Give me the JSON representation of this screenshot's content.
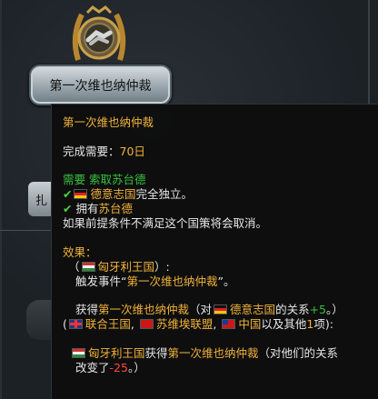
{
  "focus": {
    "name": "第一次维也纳仲裁",
    "side_label": "扎"
  },
  "tooltip": {
    "title": "第一次维也纳仲裁",
    "completion_label": "完成需要：",
    "completion_value": "70日",
    "requires_header": "需要 索取苏台德",
    "req1_country": "德意志国",
    "req1_suffix": "完全独立。",
    "req2_prefix": "拥有",
    "req2_target": "苏台德",
    "bypass_text": "如果前提条件不满足这个国策将会取消。",
    "effects_header": "效果：",
    "effect_scope_open": "（",
    "effect_scope_country": "匈牙利王国",
    "effect_scope_close": "）:",
    "trigger_prefix": "触发事件“",
    "trigger_event": "第一次维也纳仲裁",
    "trigger_suffix": "”。",
    "gain_prefix": "获得",
    "gain_item": "第一次维也纳仲裁",
    "gain_mid": "（对",
    "gain_country": "德意志国",
    "gain_relation": "的关系",
    "gain_value": "+5",
    "gain_end": "。）",
    "others_open": "(",
    "other1": "联合王国",
    "sep1": ", ",
    "other2": "苏维埃联盟",
    "sep2": ", ",
    "other3": "中国",
    "others_mid": "以及其他",
    "others_count": "1",
    "others_close": "项):",
    "sub_country": "匈牙利王国",
    "sub_gain": "获得",
    "sub_item": "第一次维也纳仲裁",
    "sub_mid": "（对他们的关系",
    "sub_line2_prefix": "改变了",
    "sub_value": "-25",
    "sub_end": "。）"
  },
  "colors": {
    "highlight": "#f0b23a",
    "positive": "#36c23c",
    "negative": "#ff4a3d"
  },
  "icons": [
    "laurel-emblem-icon",
    "handshake-icon",
    "checkmark-icon",
    "flag-icon"
  ]
}
